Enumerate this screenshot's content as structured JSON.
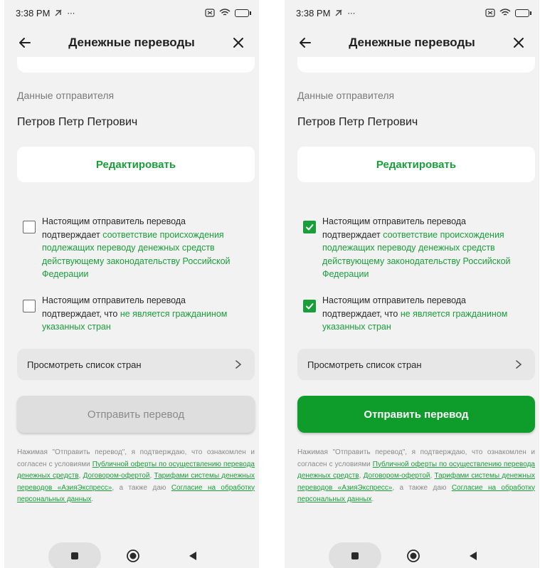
{
  "status_bar": {
    "time": "3:38 PM"
  },
  "app_bar": {
    "title": "Денежные переводы"
  },
  "sender": {
    "section_label": "Данные отправителя",
    "name": "Петров Петр Петрович"
  },
  "buttons": {
    "edit": "Редактировать",
    "countries": "Просмотреть список стран",
    "send": "Отправить перевод"
  },
  "checkbox_1": {
    "prefix": "Настоящим отправитель перевода подтверждает ",
    "link": "соответствие происхождения подлежащих переводу денежных средств действующему законодательству Российской Федерации"
  },
  "checkbox_2": {
    "prefix": "Настоящим отправитель перевода подтверждает, что ",
    "link": "не является гражданином указанных стран"
  },
  "legal": {
    "t1": "Нажимая \"Отправить перевод\", я подтверждаю, что ознакомлен и согласен с условиями ",
    "l1": "Публичной оферты по осуществлению перевода денежных средств",
    "t2": ", ",
    "l2": "Договором-офертой",
    "t3": ", ",
    "l3": "Тарифами системы денежных переводов «АзияЭкспресс»",
    "t4": ", а также даю ",
    "l4": "Согласие на обработку персональных данных",
    "t5": "."
  },
  "screens": [
    {
      "state": "unchecked",
      "checkbox_1_checked": false,
      "checkbox_2_checked": false,
      "send_enabled": false
    },
    {
      "state": "checked",
      "checkbox_1_checked": true,
      "checkbox_2_checked": true,
      "send_enabled": true
    }
  ],
  "icons": [
    "arrow-left-icon",
    "close-icon",
    "chevron-right-icon",
    "checkmark-icon",
    "battery-icon",
    "wifi-icon",
    "nav-square-icon",
    "nav-home-icon",
    "nav-back-icon"
  ],
  "colors": {
    "accent": "#1a9e3a",
    "send_enabled": "#0e9d2a",
    "send_disabled": "#dedede",
    "background": "#f2f2f2"
  }
}
